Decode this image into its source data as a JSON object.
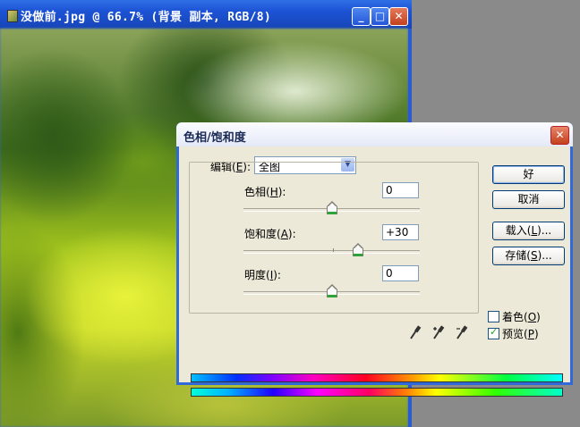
{
  "document_window": {
    "title": "没做前.jpg @ 66.7% (背景 副本, RGB/8)",
    "minimize_symbol": "_",
    "maximize_symbol": "□",
    "close_symbol": "✕"
  },
  "dialog": {
    "title": "色相/饱和度",
    "close_symbol": "✕",
    "edit": {
      "label_prefix": "编辑(",
      "label_key": "E",
      "label_suffix": "):",
      "selected": "全图",
      "arrow": "▼"
    },
    "hue": {
      "label_prefix": "色相(",
      "label_key": "H",
      "label_suffix": "):",
      "value": "0",
      "slider_fraction": 0.5
    },
    "saturation": {
      "label_prefix": "饱和度(",
      "label_key": "A",
      "label_suffix": "):",
      "value": "+30",
      "slider_fraction": 0.65
    },
    "lightness": {
      "label_prefix": "明度(",
      "label_key": "I",
      "label_suffix": "):",
      "value": "0",
      "slider_fraction": 0.5
    },
    "buttons": {
      "ok": "好",
      "cancel": "取消",
      "load_prefix": "载入(",
      "load_key": "L",
      "load_suffix": ")...",
      "save_prefix": "存储(",
      "save_key": "S",
      "save_suffix": ")..."
    },
    "colorize": {
      "label_prefix": "着色(",
      "label_key": "O",
      "label_suffix": ")",
      "checked": false
    },
    "preview": {
      "label_prefix": "预览(",
      "label_key": "P",
      "label_suffix": ")",
      "checked": true,
      "mark": "✓"
    }
  }
}
